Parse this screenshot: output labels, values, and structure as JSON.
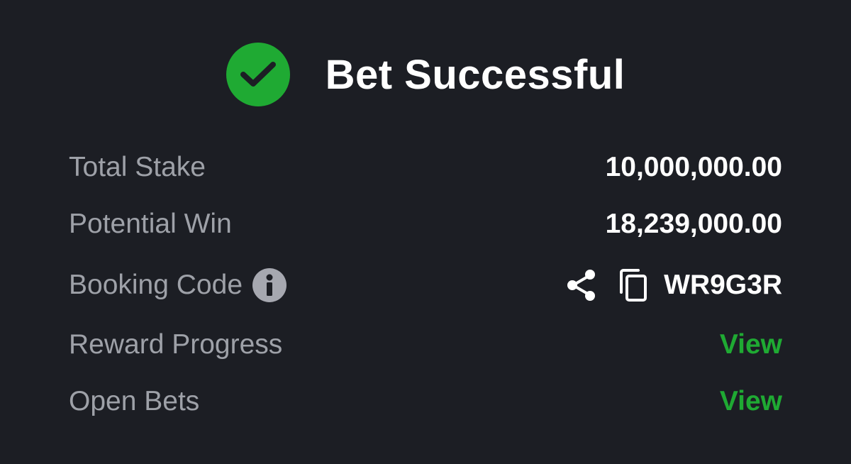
{
  "header": {
    "title": "Bet Successful",
    "icon": "check-circle-icon",
    "icon_color": "#1faa33"
  },
  "summary": {
    "total_stake": {
      "label": "Total Stake",
      "value": "10,000,000.00"
    },
    "potential_win": {
      "label": "Potential Win",
      "value": "18,239,000.00"
    },
    "booking_code": {
      "label": "Booking Code",
      "value": "WR9G3R",
      "info_icon": "info-icon",
      "share_icon": "share-icon",
      "copy_icon": "copy-icon"
    },
    "reward_progress": {
      "label": "Reward Progress",
      "link": "View"
    },
    "open_bets": {
      "label": "Open Bets",
      "link": "View"
    }
  },
  "colors": {
    "background": "#1c1e24",
    "label": "#9ea1a8",
    "value": "#ffffff",
    "link": "#1faa33"
  }
}
